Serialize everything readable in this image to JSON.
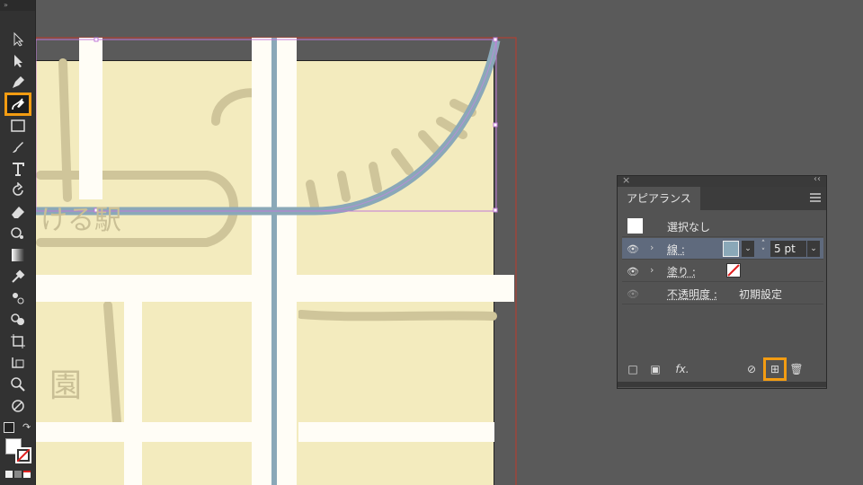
{
  "toolbar": {
    "collapse_icon": "»",
    "tools": [
      {
        "name": "selection-tool-icon"
      },
      {
        "name": "direct-selection-tool-icon"
      },
      {
        "name": "pen-tool-icon"
      },
      {
        "name": "curvature-tool-icon",
        "active": true
      },
      {
        "name": "rectangle-tool-icon"
      },
      {
        "name": "paintbrush-tool-icon"
      },
      {
        "name": "type-tool-icon"
      },
      {
        "name": "rotate-tool-icon"
      },
      {
        "name": "eraser-tool-icon"
      },
      {
        "name": "puppet-warp-tool-icon"
      },
      {
        "name": "gradient-tool-icon"
      },
      {
        "name": "eyedropper-tool-icon"
      },
      {
        "name": "blend-tool-icon"
      },
      {
        "name": "shape-builder-tool-icon"
      },
      {
        "name": "artboard-tool-icon"
      },
      {
        "name": "slice-tool-icon"
      },
      {
        "name": "zoom-tool-icon"
      },
      {
        "name": "rotate-view-tool-icon"
      }
    ]
  },
  "map": {
    "labels": [
      "ける駅",
      "園"
    ]
  },
  "panel": {
    "title": "アピアランス",
    "rows": [
      {
        "label": "選択なし"
      },
      {
        "label": "線 :",
        "value": "5 pt"
      },
      {
        "label": "塗り :"
      },
      {
        "label": "不透明度 :",
        "value": "初期設定"
      }
    ],
    "footer": {
      "fx": "fx."
    }
  },
  "colors": {
    "accent": "#f39c12",
    "stroke": "#8aa8b8",
    "map_bg": "#f3ebbe"
  }
}
